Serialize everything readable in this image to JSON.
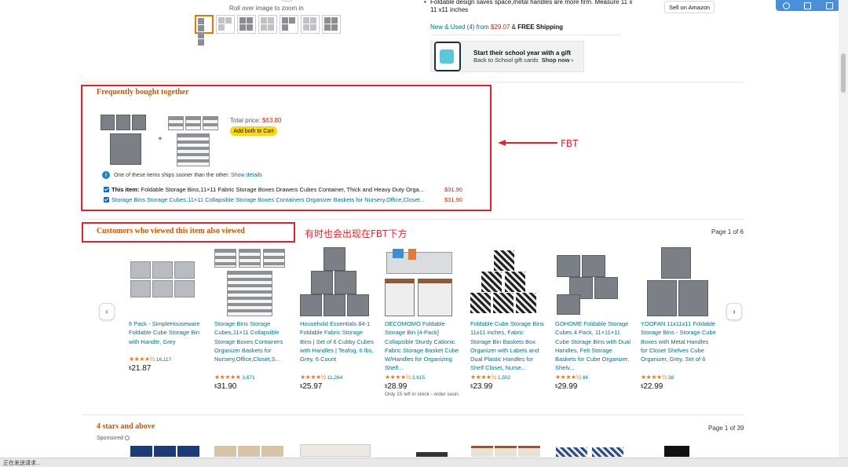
{
  "top": {
    "rollover": "Roll over image to zoom in",
    "bullet": "Foldable design saves space,metal handles are more firm. Measure 11 x 11 x11 inches",
    "new_used_link": "New & Used (4) from",
    "new_used_price": "$29.07",
    "new_used_amp": "&",
    "free_shipping": "FREE Shipping",
    "gift_title": "Start their school year with a gift",
    "gift_sub": "Back to School gift cards",
    "gift_shop": "Shop now ›",
    "sell_button": "Sell on Amazon"
  },
  "fbt": {
    "title": "Frequently bought together",
    "total_label": "Total price:",
    "total_price": "$63.80",
    "add_button": "Add both to Cart",
    "ship_note": "One of these items ships sooner than the other.",
    "show_details": "Show details",
    "item1_prefix": "This item:",
    "item1_title": "Foldable Storage Bins,11×11 Fabric Storage Boxes Drawers Cubes Container, Thick and Heavy Duty Orga...",
    "item1_price": "$31.90",
    "item2_title": "Storage Bins Storage Cubes,11×11 Collapsible Storage Boxes Containers Organizer Baskets for Nursery,Office,Closet...",
    "item2_price": "$31.90",
    "annotation": "FBT"
  },
  "viewed": {
    "title": "Customers who viewed this item also viewed",
    "annotation": "有时也会出现在FBT下方",
    "page_of": "Page 1 of 6",
    "prev": "‹",
    "next": "›",
    "items": [
      {
        "title": "6 Pack - SimpleHouseware Foldable Cube Storage Bin with Handle, Grey",
        "stars": "★★★★½",
        "count": "16,117",
        "price": "21.87",
        "currency": "$",
        "stock": ""
      },
      {
        "title": "Storage Bins Storage Cubes,11×11 Collapsible Storage Boxes Containers Organizer Baskets for Nursery,Office,Closet,S...",
        "stars": "★★★★★",
        "count": "3,671",
        "price": "31.90",
        "currency": "$",
        "stock": ""
      },
      {
        "title": "Household Essentials 84-1 Foldable Fabric Storage Bins | Set of 6 Cubby Cubes with Handles | Teafog, 6 lbs, Grey, 6 Count",
        "stars": "★★★★½",
        "count": "11,264",
        "price": "25.97",
        "currency": "$",
        "stock": ""
      },
      {
        "title": "DECOMOMO Foldable Storage Bin [4-Pack] Collapsible Sturdy Cationic Fabric Storage Basket Cube W/Handles for Organizing Shelf...",
        "stars": "★★★★½",
        "count": "2,615",
        "price": "28.99",
        "currency": "$",
        "stock": "Only 15 left in stock - order soon."
      },
      {
        "title": "Foldable Cube Storage Bins 11x11 inches, Fabric Storage Bin Baskets Box Organizer with Labels and Dual Plastic Handles for Shelf Closet, Nurse...",
        "stars": "★★★★½",
        "count": "1,502",
        "price": "23.99",
        "currency": "$",
        "stock": ""
      },
      {
        "title": "GOHOME Foldable Storage Cubes 4 Pack, 11×11×11 Cube Storage Bins with Dual Handles, Felt Storage Baskets for Cube Organizer, Shelv...",
        "stars": "★★★★½",
        "count": "86",
        "price": "29.99",
        "currency": "$",
        "stock": ""
      },
      {
        "title": "YOOFAN 11x11x11 Foldable Storage Bins - Storage Cube Boxes with Metal Handles for Closet Shelves Cube Organizer, Grey, Set of 6",
        "stars": "★★★★½",
        "count": "38",
        "price": "22.99",
        "currency": "$",
        "stock": ""
      }
    ]
  },
  "four_stars": {
    "title": "4 stars and above",
    "sponsored": "Sponsored",
    "page_of": "Page 1 of 39"
  },
  "status": "正在发送请求..."
}
